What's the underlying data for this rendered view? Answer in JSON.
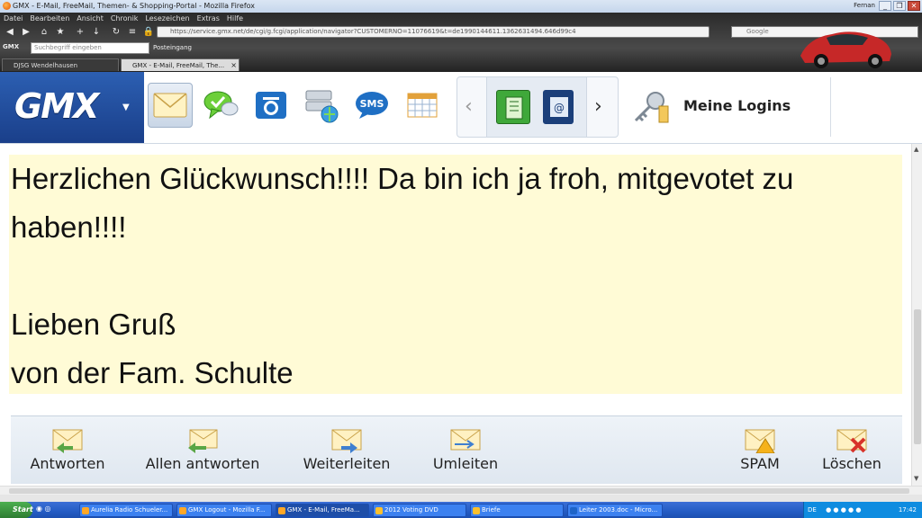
{
  "window": {
    "title": "GMX - E-Mail, FreeMail, Themen- & Shopping-Portal - Mozilla Firefox",
    "user": "Fernan",
    "buttons": [
      "_",
      "❐",
      "✕"
    ]
  },
  "menubar": [
    "Datei",
    "Bearbeiten",
    "Ansicht",
    "Chronik",
    "Lesezeichen",
    "Extras",
    "Hilfe"
  ],
  "navigation": {
    "url": "https://service.gmx.net/de/cgi/g.fcgi/application/navigator?CUSTOMERNO=11076619&t=de1990144611.1362631494.646d99c4",
    "search_engine": "Google",
    "search_placeholder": "Google"
  },
  "gmx_toolbar": {
    "search_placeholder": "Suchbegriff eingeben",
    "posteingang": "Posteingang"
  },
  "tabs": [
    {
      "label": "DJSG Wendelhausen",
      "active": false
    },
    {
      "label": "GMX - E-Mail, FreeMail, The...",
      "active": true
    }
  ],
  "header": {
    "logo": "GMX",
    "logins_label": "Meine Logins",
    "icons": [
      "mail-icon",
      "chat-icon",
      "camera-icon",
      "drive-icon",
      "sms-icon",
      "calendar-icon"
    ],
    "carousel_icons": [
      "address-book-icon",
      "contacts-icon"
    ]
  },
  "message": {
    "paragraphs": [
      "Herzlichen Glückwunsch!!!! Da bin ich ja froh, mitgevotet zu haben!!!!",
      "",
      "Lieben Gruß\nvon der Fam. Schulte"
    ]
  },
  "actions": [
    {
      "label": "Antworten",
      "icon": "reply-icon"
    },
    {
      "label": "Allen antworten",
      "icon": "reply-all-icon"
    },
    {
      "label": "Weiterleiten",
      "icon": "forward-icon"
    },
    {
      "label": "Umleiten",
      "icon": "redirect-icon"
    },
    {
      "label": "SPAM",
      "icon": "spam-icon"
    },
    {
      "label": "Löschen",
      "icon": "delete-icon"
    }
  ],
  "taskbar": {
    "start": "Start",
    "tasks": [
      {
        "label": "Aurelia Radio Schueler...",
        "active": false
      },
      {
        "label": "GMX Logout - Mozilla F...",
        "active": false
      },
      {
        "label": "GMX - E-Mail, FreeMa...",
        "active": true
      },
      {
        "label": "2012 Voting DVD",
        "active": false
      },
      {
        "label": "Briefe",
        "active": false
      },
      {
        "label": "Leiter 2003.doc - Micro...",
        "active": false
      }
    ],
    "lang": "DE",
    "clock": "17:42"
  },
  "colors": {
    "gmx_blue": "#1a3f8a",
    "message_bg": "#fffbd6",
    "taskbar": "#245cc4"
  }
}
